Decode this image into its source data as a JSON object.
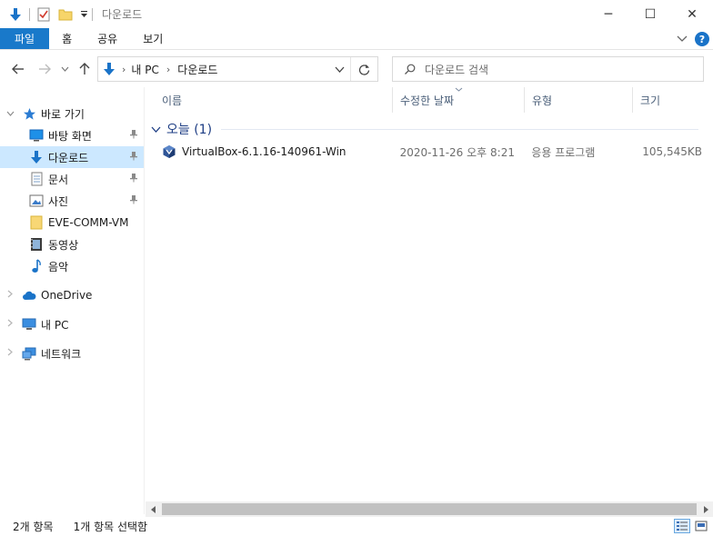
{
  "window": {
    "title": "다운로드",
    "controls": {
      "minimize": "─",
      "maximize": "☐",
      "close": "✕"
    }
  },
  "ribbon": {
    "tabs": [
      "파일",
      "홈",
      "공유",
      "보기"
    ],
    "help": "?"
  },
  "nav": {
    "breadcrumb": [
      "내 PC",
      "다운로드"
    ],
    "search_placeholder": "다운로드 검색"
  },
  "sidebar": {
    "quick_access": "바로 가기",
    "items": [
      {
        "label": "바탕 화면",
        "icon": "desktop-icon",
        "pinned": true
      },
      {
        "label": "다운로드",
        "icon": "download-arrow-icon",
        "pinned": true,
        "selected": true
      },
      {
        "label": "문서",
        "icon": "document-icon",
        "pinned": true
      },
      {
        "label": "사진",
        "icon": "pictures-icon",
        "pinned": true
      },
      {
        "label": "EVE-COMM-VM",
        "icon": "folder-icon",
        "pinned": false
      },
      {
        "label": "동영상",
        "icon": "video-icon",
        "pinned": false
      },
      {
        "label": "음악",
        "icon": "music-note-icon",
        "pinned": false
      }
    ],
    "onedrive": "OneDrive",
    "this_pc": "내 PC",
    "network": "네트워크"
  },
  "columns": {
    "name": "이름",
    "date": "수정한 날짜",
    "type": "유형",
    "size": "크기"
  },
  "group": {
    "label": "오늘 (1)"
  },
  "files": [
    {
      "name": "VirtualBox-6.1.16-140961-Win",
      "date": "2020-11-26 오후 8:21",
      "type": "응용 프로그램",
      "size": "105,545KB",
      "icon": "virtualbox-icon"
    }
  ],
  "status": {
    "count": "2개 항목",
    "selected": "1개 항목 선택함"
  },
  "colors": {
    "accent": "#1979ca",
    "selection": "#cce8ff",
    "group_text": "#1e3e84"
  }
}
